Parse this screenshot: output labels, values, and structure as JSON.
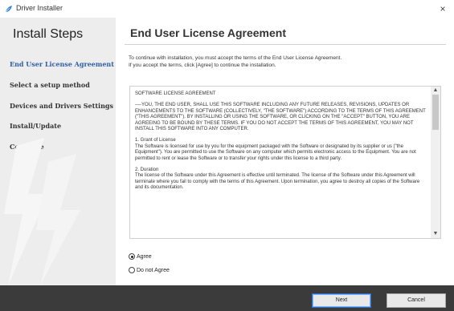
{
  "window": {
    "title": "Driver Installer",
    "icon": "blue-feather-icon",
    "close_glyph": "×",
    "accent_color": "#2e5fa8"
  },
  "sidebar": {
    "title": "Install Steps",
    "items": [
      {
        "label": "End User License Agreement",
        "active": true
      },
      {
        "label": "Select a setup method",
        "active": false
      },
      {
        "label": "Devices and Drivers Settings",
        "active": false
      },
      {
        "label": "Install/Update",
        "active": false
      },
      {
        "label": "Complete",
        "active": false
      }
    ]
  },
  "main": {
    "title": "End User License Agreement",
    "intro_line1": "To continue with installation, you must accept the terms of the End User License Agreement.",
    "intro_line2": "If you accept the terms, click [Agree] to continue the installation.",
    "license": {
      "heading": "SOFTWARE LICENSE AGREEMENT",
      "para1": "----YOU, THE END USER, SHALL USE THIS SOFTWARE INCLUDING ANY FUTURE RELEASES, REVISIONS, UPDATES OR ENHANCEMENTS TO THE SOFTWARE (COLLECTIVELY, \"THE SOFTWARE\") ACCORDING TO THE TERMS OF THIS AGREEMENT (\"THIS AGREEMENT\"). BY INSTALLING OR USING THE SOFTWARE, OR CLICKING ON THE \"ACCEPT\" BUTTON, YOU ARE AGREEING TO BE BOUND BY THESE TERMS. IF YOU DO NOT ACCEPT THE TERMS OF THIS AGREEMENT, YOU MAY NOT INSTALL THIS SOFTWARE INTO ANY COMPUTER.",
      "section1_title": "1. Grant of License",
      "section1_text": "The Software is licensed for use by you for the equipment packaged with the Software or designated by its supplier or us (\"the Equipment\"). You are permitted to use the Software on any computer which permits electronic access to the Equipment. You are not permitted to rent or lease the Software or to transfer your rights under this license to a third party.",
      "section2_title": "2. Duration",
      "section2_text": "The license of the Software under this Agreement is effective until terminated. The license of the Software under this Agreement will terminate where you fail to comply with the terms of this Agreement. Upon termination, you agree to destroy all copies of the Software and its documentation."
    },
    "options": [
      {
        "label": "Agree",
        "checked": true
      },
      {
        "label": "Do not Agree",
        "checked": false
      }
    ]
  },
  "footer": {
    "next_label": "Next",
    "cancel_label": "Cancel"
  }
}
